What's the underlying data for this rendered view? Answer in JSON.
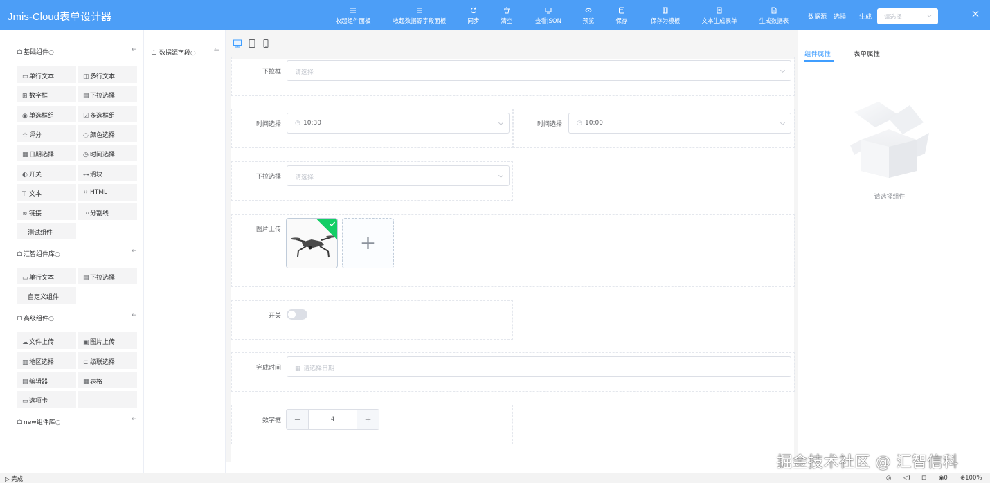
{
  "header": {
    "title": "Jmis-Cloud表单设计器",
    "toolbar": [
      {
        "label": "收起组件面板",
        "icon": "list-icon"
      },
      {
        "label": "收起数据源字段面板",
        "icon": "list-icon"
      },
      {
        "label": "同步",
        "icon": "refresh-icon"
      },
      {
        "label": "清空",
        "icon": "delete-icon"
      },
      {
        "label": "查看JSON",
        "icon": "monitor-icon"
      },
      {
        "label": "预览",
        "icon": "eye-icon"
      },
      {
        "label": "保存",
        "icon": "save-icon"
      },
      {
        "label": "保存为模板",
        "icon": "template-icon"
      },
      {
        "label": "文本生成表单",
        "icon": "document-icon"
      },
      {
        "label": "生成数据表",
        "icon": "document-icon"
      }
    ],
    "datasource_label": "数据源",
    "select_label": "选择",
    "generate_label": "生成",
    "select_placeholder": "请选择"
  },
  "groups": [
    {
      "title": "基础组件",
      "items": [
        {
          "label": "单行文本",
          "icon": "input-icon"
        },
        {
          "label": "多行文本",
          "icon": "textarea-icon"
        },
        {
          "label": "数字框",
          "icon": "number-icon"
        },
        {
          "label": "下拉选择",
          "icon": "select-icon"
        },
        {
          "label": "单选框组",
          "icon": "radio-icon"
        },
        {
          "label": "多选框组",
          "icon": "checkbox-icon"
        },
        {
          "label": "评分",
          "icon": "star-icon"
        },
        {
          "label": "颜色选择",
          "icon": "palette-icon"
        },
        {
          "label": "日期选择",
          "icon": "calendar-icon"
        },
        {
          "label": "时间选择",
          "icon": "clock-icon"
        },
        {
          "label": "开关",
          "icon": "switch-icon"
        },
        {
          "label": "滑块",
          "icon": "slider-icon"
        },
        {
          "label": "文本",
          "icon": "text-icon"
        },
        {
          "label": "HTML",
          "icon": "code-icon"
        },
        {
          "label": "链接",
          "icon": "link-icon"
        },
        {
          "label": "分割线",
          "icon": "divider-icon"
        },
        {
          "label": "测试组件",
          "icon": ""
        }
      ]
    },
    {
      "title": "汇智组件库",
      "items": [
        {
          "label": "单行文本",
          "icon": "input-icon"
        },
        {
          "label": "下拉选择",
          "icon": "select-icon"
        },
        {
          "label": "自定义组件",
          "icon": ""
        }
      ]
    },
    {
      "title": "高级组件",
      "items": [
        {
          "label": "文件上传",
          "icon": "cloud-upload-icon"
        },
        {
          "label": "图片上传",
          "icon": "image-icon"
        },
        {
          "label": "地区选择",
          "icon": "region-icon"
        },
        {
          "label": "级联选择",
          "icon": "cascader-icon"
        },
        {
          "label": "编辑器",
          "icon": "editor-icon"
        },
        {
          "label": "表格",
          "icon": "table-icon"
        },
        {
          "label": "选项卡",
          "icon": "tabs-icon"
        }
      ]
    },
    {
      "title": "new组件库",
      "items": []
    }
  ],
  "fields_panel": {
    "title": "数据源字段"
  },
  "form": {
    "dropdown": {
      "label": "下拉框",
      "placeholder": "请选择"
    },
    "time1": {
      "label": "时间选择",
      "value": "10:30"
    },
    "time2": {
      "label": "时间选择",
      "value": "10:00"
    },
    "select2": {
      "label": "下拉选择",
      "placeholder": "请选择"
    },
    "image_upload": {
      "label": "图片上传"
    },
    "switch": {
      "label": "开关"
    },
    "finish_time": {
      "label": "完成时间",
      "placeholder": "请选择日期"
    },
    "number": {
      "label": "数字框",
      "value": "4"
    }
  },
  "right_panel": {
    "tabs": [
      "组件属性",
      "表单属性"
    ],
    "empty_text": "请选择组件"
  },
  "watermark": "掘金技术社区 @ 汇智信科",
  "statusbar": {
    "left": "完成",
    "zoom": "100%",
    "badge_count": "0"
  },
  "colors": {
    "header_bg": "#4c9ef7",
    "accent": "#409eff",
    "success": "#13ce66"
  }
}
